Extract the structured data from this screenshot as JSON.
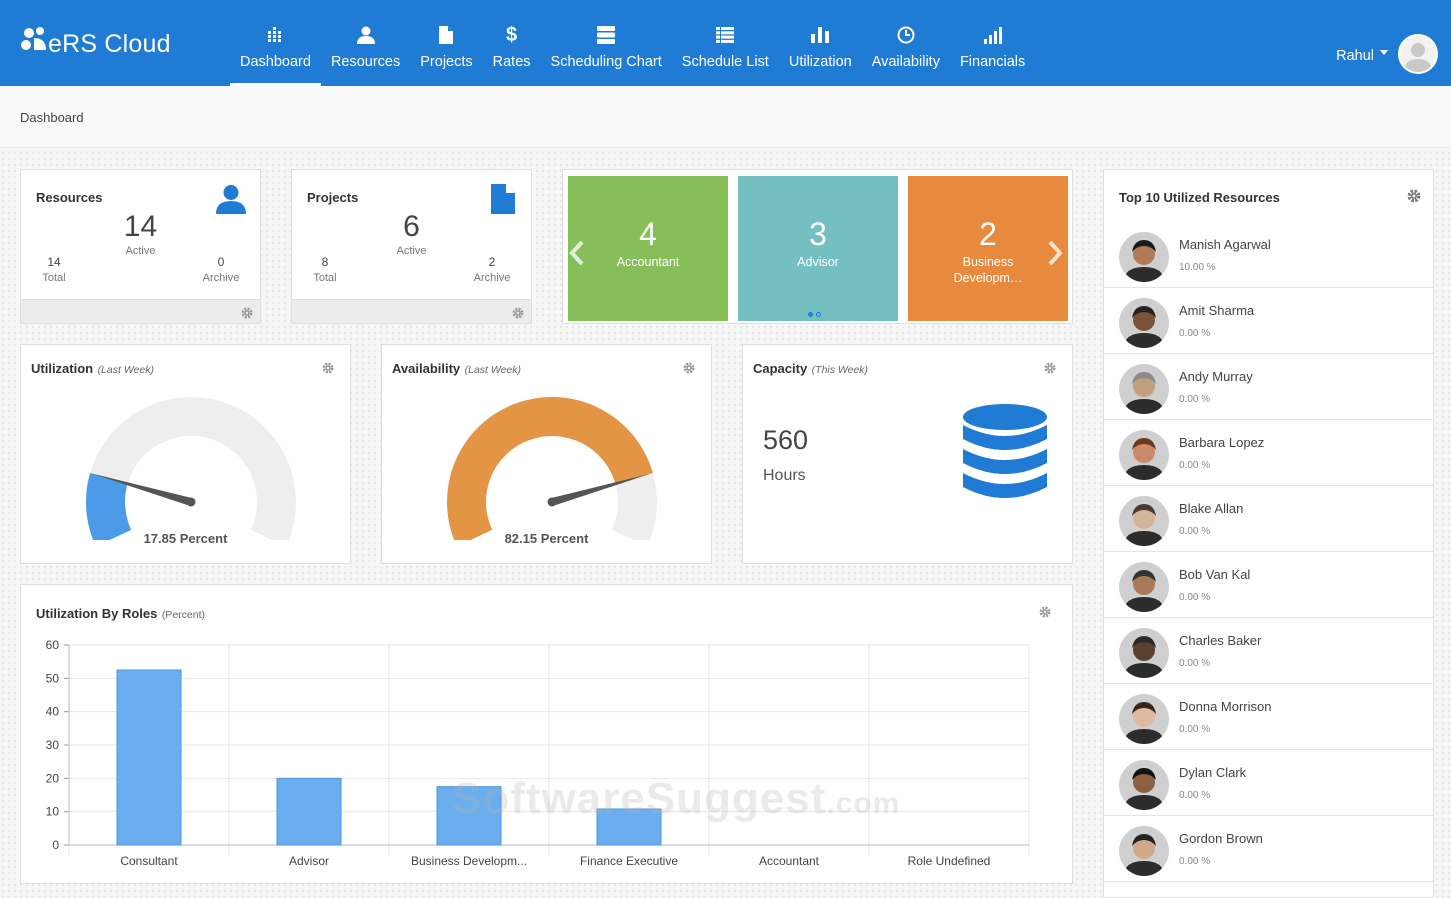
{
  "app": {
    "name": "eRS Cloud"
  },
  "nav": [
    {
      "label": "Dashboard",
      "icon": "dashboard-icon",
      "active": true
    },
    {
      "label": "Resources",
      "icon": "user-icon"
    },
    {
      "label": "Projects",
      "icon": "file-icon"
    },
    {
      "label": "Rates",
      "icon": "dollar-icon"
    },
    {
      "label": "Scheduling Chart",
      "icon": "server-icon"
    },
    {
      "label": "Schedule List",
      "icon": "list-icon"
    },
    {
      "label": "Utilization",
      "icon": "bar-chart-icon"
    },
    {
      "label": "Availability",
      "icon": "clock-icon"
    },
    {
      "label": "Financials",
      "icon": "signal-icon"
    }
  ],
  "user": {
    "name": "Rahul"
  },
  "breadcrumb": "Dashboard",
  "resources_card": {
    "title": "Resources",
    "active_count": "14",
    "active_label": "Active",
    "total_count": "14",
    "total_label": "Total",
    "archive_count": "0",
    "archive_label": "Archive"
  },
  "projects_card": {
    "title": "Projects",
    "active_count": "6",
    "active_label": "Active",
    "total_count": "8",
    "total_label": "Total",
    "archive_count": "2",
    "archive_label": "Archive"
  },
  "roles_carousel": [
    {
      "count": "4",
      "label": "Accountant",
      "color": "#86bf5a"
    },
    {
      "count": "3",
      "label": "Advisor",
      "color": "#74bfc0"
    },
    {
      "count": "2",
      "label": "Business Developm…",
      "color": "#e78a3e"
    }
  ],
  "utilization": {
    "title": "Utilization",
    "period": "(Last Week)",
    "value": 17.85,
    "value_text": "17.85 Percent",
    "color": "#4c9be8"
  },
  "availability": {
    "title": "Availability",
    "period": "(Last Week)",
    "value": 82.15,
    "value_text": "82.15 Percent",
    "color": "#e39445"
  },
  "capacity": {
    "title": "Capacity",
    "period": "(This Week)",
    "value": "560",
    "unit": "Hours"
  },
  "top_resources": {
    "title": "Top 10 Utilized Resources",
    "items": [
      {
        "name": "Manish Agarwal",
        "pct": "10.00 %"
      },
      {
        "name": "Amit Sharma",
        "pct": "0.00 %"
      },
      {
        "name": "Andy Murray",
        "pct": "0.00 %"
      },
      {
        "name": "Barbara Lopez",
        "pct": "0.00 %"
      },
      {
        "name": "Blake Allan",
        "pct": "0.00 %"
      },
      {
        "name": "Bob Van Kal",
        "pct": "0.00 %"
      },
      {
        "name": "Charles Baker",
        "pct": "0.00 %"
      },
      {
        "name": "Donna Morrison",
        "pct": "0.00 %"
      },
      {
        "name": "Dylan Clark",
        "pct": "0.00 %"
      },
      {
        "name": "Gordon Brown",
        "pct": "0.00 %"
      }
    ]
  },
  "roles_chart": {
    "title": "Utilization By Roles",
    "sub": "(Percent)"
  },
  "chart_data": {
    "type": "bar",
    "title": "Utilization By Roles",
    "subtitle": "(Percent)",
    "categories": [
      "Consultant",
      "Advisor",
      "Business Developm...",
      "Finance Executive",
      "Accountant",
      "Role Undefined"
    ],
    "values": [
      52.5,
      20,
      17.5,
      10.8,
      0,
      0
    ],
    "ylim": [
      0,
      60
    ],
    "yticks": [
      0,
      10,
      20,
      30,
      40,
      50,
      60
    ],
    "grid": true,
    "color": "#6aaeef"
  },
  "watermark": {
    "main": "SoftwareSuggest",
    "suffix": ".com"
  }
}
